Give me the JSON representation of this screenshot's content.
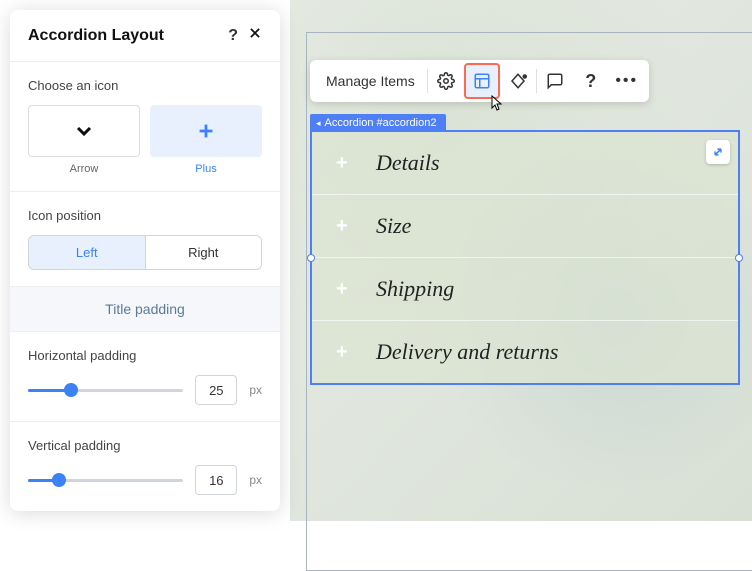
{
  "panel": {
    "title": "Accordion Layout",
    "help": "?",
    "choose_icon_label": "Choose an icon",
    "icons": {
      "arrow": "Arrow",
      "plus": "Plus"
    },
    "icon_position_label": "Icon position",
    "positions": {
      "left": "Left",
      "right": "Right"
    },
    "padding_heading": "Title padding",
    "horizontal_label": "Horizontal padding",
    "horizontal_value": "25",
    "vertical_label": "Vertical padding",
    "vertical_value": "16",
    "unit": "px"
  },
  "toolbar": {
    "manage": "Manage Items"
  },
  "breadcrumb": {
    "label": "Accordion #accordion2"
  },
  "accordion": {
    "items": [
      {
        "title": "Details"
      },
      {
        "title": "Size"
      },
      {
        "title": "Shipping"
      },
      {
        "title": "Delivery and returns"
      }
    ]
  }
}
